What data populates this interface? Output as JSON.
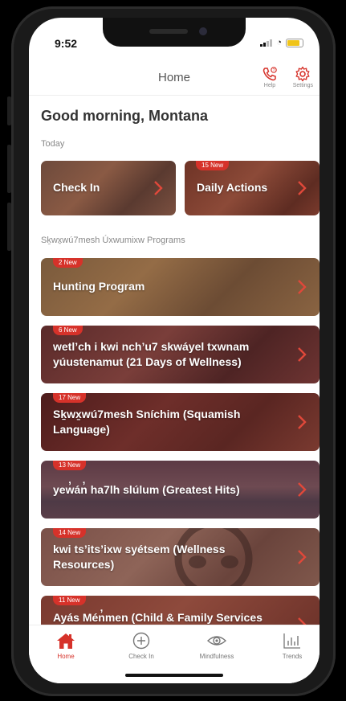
{
  "status": {
    "time": "9:52"
  },
  "header": {
    "title": "Home",
    "help_label": "Help",
    "settings_label": "Settings"
  },
  "greeting": "Good morning, Montana",
  "today_label": "Today",
  "today_cards": [
    {
      "label": "Check In",
      "badge": ""
    },
    {
      "label": "Daily Actions",
      "badge": "15 New"
    }
  ],
  "programs_label": "Sḵwx̱wú7mesh Úxwumixw Programs",
  "programs": [
    {
      "label": "Hunting Program",
      "badge": "2 New"
    },
    {
      "label": "wetl’ch i kwi nch’u7 skwáyel  txwnam yúustenamut (21 Days of Wellness)",
      "badge": "6 New"
    },
    {
      "label": "Sḵwx̱wú7mesh Sníchim (Squamish Language)",
      "badge": "17 New"
    },
    {
      "label": "yew̓án̓ ha7lh slúlum (Greatest Hits)",
      "badge": "13 New"
    },
    {
      "label": "kwi  ts’its’ixw  syétsem (Wellness Resources)",
      "badge": "14 New"
    },
    {
      "label": "Ayás Mén̓men (Child & Family Services",
      "badge": "11 New"
    }
  ],
  "tabs": [
    {
      "label": "Home",
      "icon": "home-icon",
      "active": true
    },
    {
      "label": "Check In",
      "icon": "plus-circle-icon",
      "active": false
    },
    {
      "label": "Mindfulness",
      "icon": "eye-icon",
      "active": false
    },
    {
      "label": "Trends",
      "icon": "bar-chart-icon",
      "active": false
    }
  ],
  "colors": {
    "accent": "#d6322a",
    "text": "#333333"
  }
}
